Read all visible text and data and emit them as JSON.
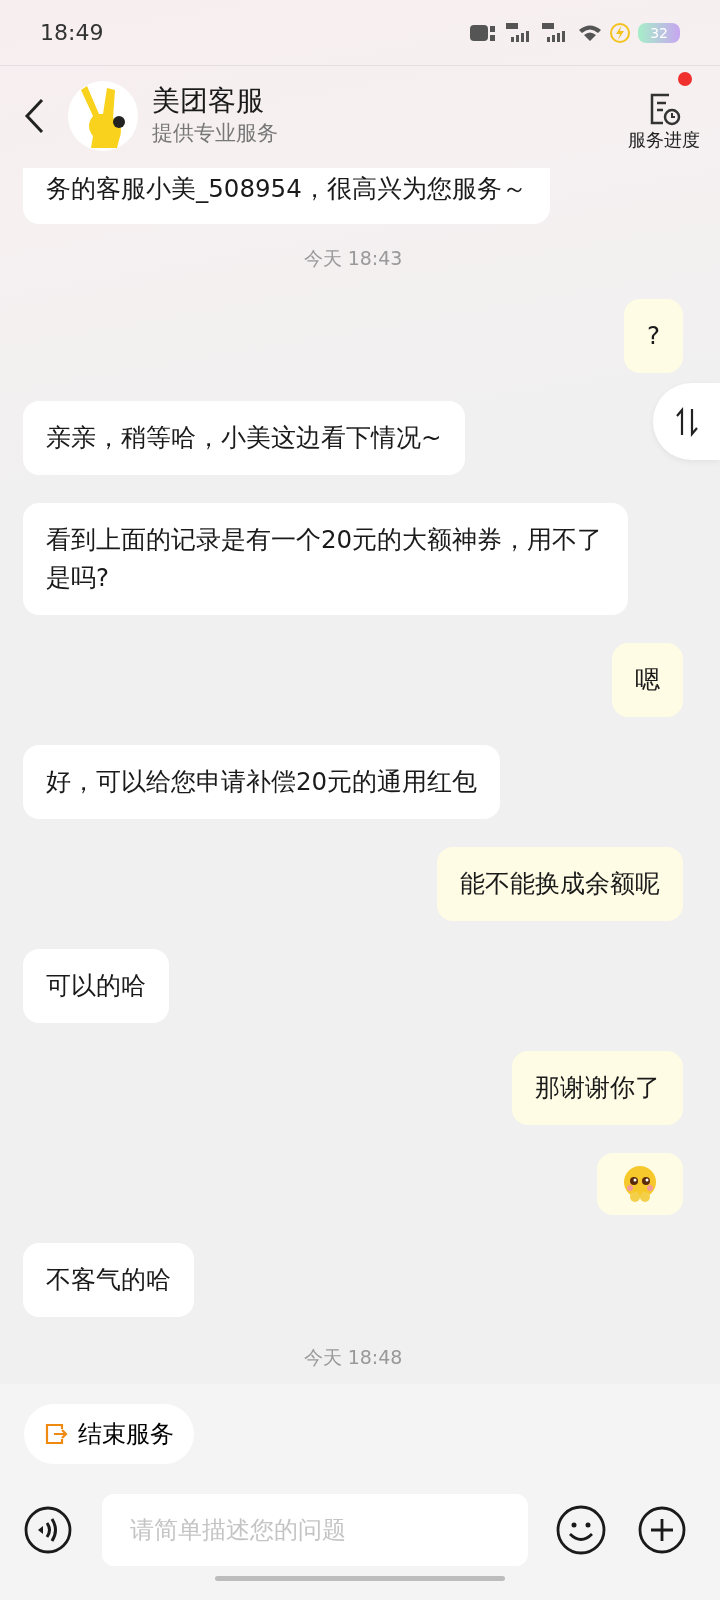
{
  "status_bar": {
    "time": "18:49",
    "battery": "32"
  },
  "header": {
    "title": "美团客服",
    "subtitle": "提供专业服务",
    "progress_button": {
      "label": "服务进度",
      "has_notification": true
    }
  },
  "messages": [
    {
      "kind": "text",
      "outgoing": false,
      "text": "务的客服小美_508954，很高兴为您服务～"
    },
    {
      "kind": "time",
      "text": "今天 18:43"
    },
    {
      "kind": "text",
      "outgoing": true,
      "text": "?"
    },
    {
      "kind": "text",
      "outgoing": false,
      "text": "亲亲，稍等哈，小美这边看下情况~"
    },
    {
      "kind": "text",
      "outgoing": false,
      "text": "看到上面的记录是有一个20元的大额神券，用不了是吗?"
    },
    {
      "kind": "text",
      "outgoing": true,
      "text": "嗯"
    },
    {
      "kind": "text",
      "outgoing": false,
      "text": "好，可以给您申请补偿20元的通用红包"
    },
    {
      "kind": "text",
      "outgoing": true,
      "text": "能不能换成余额呢"
    },
    {
      "kind": "text",
      "outgoing": false,
      "text": "可以的哈"
    },
    {
      "kind": "text",
      "outgoing": true,
      "text": "那谢谢你了"
    },
    {
      "kind": "sticker",
      "outgoing": true
    },
    {
      "kind": "text",
      "outgoing": false,
      "text": "不客气的哈"
    },
    {
      "kind": "time",
      "text": "今天 18:48"
    }
  ],
  "end_service_button": {
    "label": "结束服务"
  },
  "input": {
    "placeholder": "请简单描述您的问题"
  }
}
